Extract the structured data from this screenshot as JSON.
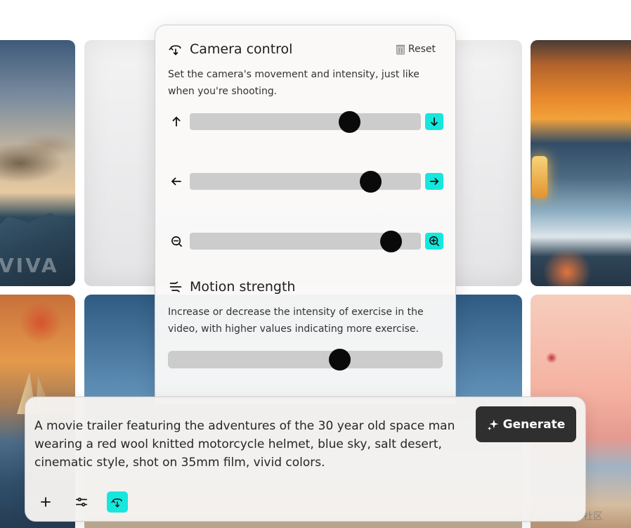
{
  "camera_control": {
    "title": "Camera control",
    "reset_label": "Reset",
    "description": "Set the camera's movement and intensity, just like when you're shooting.",
    "sliders": [
      {
        "name": "vertical",
        "left_icon": "arrow-up-icon",
        "right_icon": "arrow-down-icon",
        "value": 0.69
      },
      {
        "name": "horizontal",
        "left_icon": "arrow-left-icon",
        "right_icon": "arrow-right-icon",
        "value": 0.78
      },
      {
        "name": "zoom",
        "left_icon": "zoom-out-icon",
        "right_icon": "zoom-in-icon",
        "value": 0.87
      }
    ]
  },
  "motion_strength": {
    "title": "Motion strength",
    "description": "Increase or decrease the intensity of exercise in the video, with higher values indicating more exercise.",
    "value": 0.625
  },
  "prompt": {
    "text": "A movie trailer featuring the adventures of the 30 year old space man wearing a red wool knitted motorcycle helmet, blue sky, salt desert, cinematic style, shot on 35mm film, vivid colors.",
    "generate_label": "Generate",
    "tools": [
      "add-icon",
      "settings-sliders-icon",
      "camera-movement-icon"
    ]
  },
  "gallery": {
    "watermark_top": "VIVA",
    "footer_watermark": "@稀土掘金技术社区"
  },
  "colors": {
    "accent": "#16e7dd",
    "button_dark": "#2f2f2f",
    "track": "#cccccc",
    "thumb": "#0a0a0a"
  }
}
